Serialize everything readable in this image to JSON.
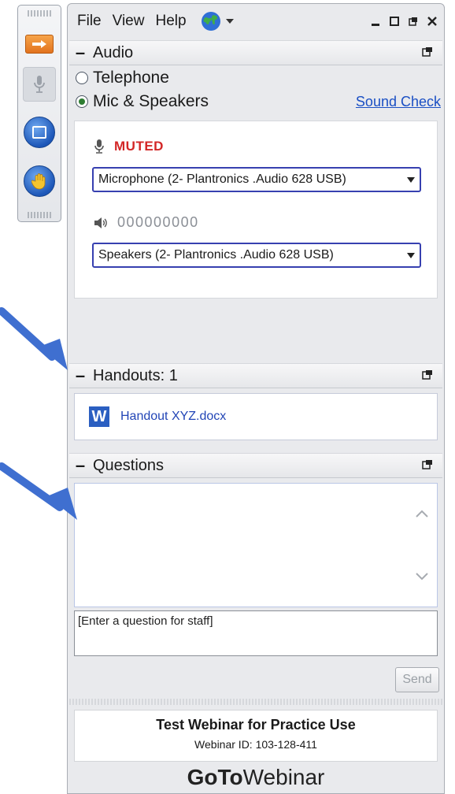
{
  "menu": {
    "file": "File",
    "view": "View",
    "help": "Help"
  },
  "audio": {
    "header": "Audio",
    "options": [
      "Telephone",
      "Mic & Speakers"
    ],
    "selected_option": "Mic & Speakers",
    "sound_check": "Sound Check",
    "mic_status": "MUTED",
    "microphone_select": "Microphone (2- Plantronics .Audio 628 USB)",
    "speaker_level": "000000000",
    "speakers_select": "Speakers (2- Plantronics .Audio 628 USB)"
  },
  "handouts": {
    "header": "Handouts: 1",
    "file": "Handout XYZ.docx",
    "icon_letter": "W"
  },
  "questions": {
    "header": "Questions",
    "input_value": "[Enter a question for staff]",
    "send_label": "Send"
  },
  "webinar": {
    "title": "Test Webinar for Practice Use",
    "id_line": "Webinar ID: 103-128-411",
    "brand_bold": "GoTo",
    "brand_light": "Webinar"
  },
  "colors": {
    "muted": "#d32727",
    "link": "#1a4fc4",
    "select_border": "#3740b0",
    "arrow": "#3f6fd0"
  }
}
